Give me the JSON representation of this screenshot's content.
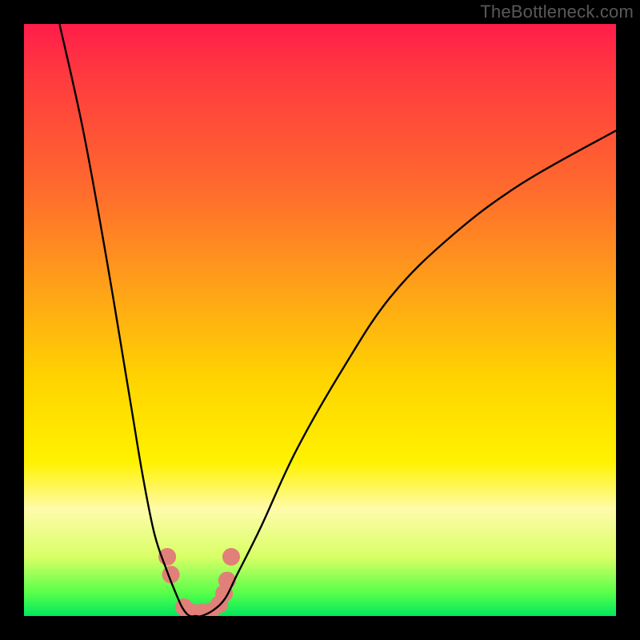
{
  "attribution": "TheBottleneck.com",
  "chart_data": {
    "type": "line",
    "title": "",
    "xlabel": "",
    "ylabel": "",
    "xlim": [
      0,
      100
    ],
    "ylim": [
      0,
      100
    ],
    "background_gradient": {
      "top": "#ff1d4a",
      "mid_upper": "#ffa318",
      "mid_lower": "#fff200",
      "bottom": "#00e85e"
    },
    "series": [
      {
        "name": "bottleneck-curve",
        "stroke": "#000000",
        "x": [
          6,
          10,
          14,
          18,
          20,
          22,
          24,
          26,
          27,
          28,
          29,
          30,
          32,
          34,
          36,
          40,
          46,
          54,
          62,
          72,
          84,
          100
        ],
        "y": [
          100,
          82,
          60,
          36,
          24,
          14,
          8,
          3,
          1,
          0,
          0,
          0,
          1,
          3,
          7,
          15,
          28,
          42,
          54,
          64,
          73,
          82
        ]
      }
    ],
    "markers": {
      "name": "highlight-dots",
      "color": "#e08078",
      "radius_px": 11,
      "points_xy": [
        [
          24.2,
          10.0
        ],
        [
          24.8,
          7.0
        ],
        [
          27.0,
          1.5
        ],
        [
          28.5,
          0.6
        ],
        [
          30.0,
          0.6
        ],
        [
          31.5,
          0.8
        ],
        [
          33.0,
          2.0
        ],
        [
          33.8,
          3.8
        ],
        [
          34.3,
          6.0
        ],
        [
          35.0,
          10.0
        ]
      ]
    }
  }
}
